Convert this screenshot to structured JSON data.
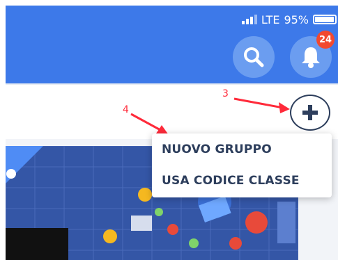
{
  "status_bar": {
    "network": "LTE",
    "battery": "95%",
    "battery_level": 0.95
  },
  "header": {
    "search_icon": "search-icon",
    "notification_icon": "bell-icon",
    "notification_count": "24",
    "accent_color": "#3d79e9",
    "badge_color": "#f2492f"
  },
  "add_button": {
    "icon": "plus-icon"
  },
  "annotations": {
    "label_3": "3",
    "label_4": "4",
    "color": "#ff2a3a"
  },
  "menu": {
    "items": [
      {
        "label": "NUOVO GRUPPO"
      },
      {
        "label": "USA CODICE CLASSE"
      }
    ]
  }
}
